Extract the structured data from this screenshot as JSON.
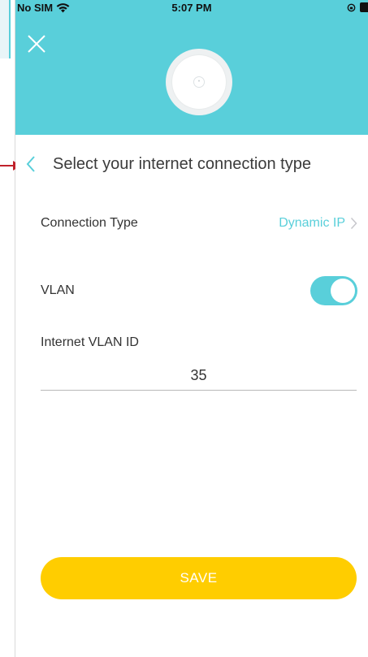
{
  "status_bar": {
    "carrier": "No SIM",
    "time": "5:07 PM"
  },
  "icons": {
    "close": "close-icon",
    "back": "chevron-left-icon",
    "chevron": "chevron-right-icon",
    "wifi": "wifi-icon",
    "device": "ceiling-access-point-icon"
  },
  "colors": {
    "accent": "#59cfda",
    "save_button": "#ffcd00",
    "annotation_arrow": "#c0212b"
  },
  "page": {
    "title": "Select your internet connection type"
  },
  "connection": {
    "label": "Connection Type",
    "value": "Dynamic IP"
  },
  "vlan": {
    "label": "VLAN",
    "enabled": true
  },
  "vlan_id": {
    "label": "Internet VLAN ID",
    "value": "35"
  },
  "actions": {
    "save_label": "SAVE"
  }
}
